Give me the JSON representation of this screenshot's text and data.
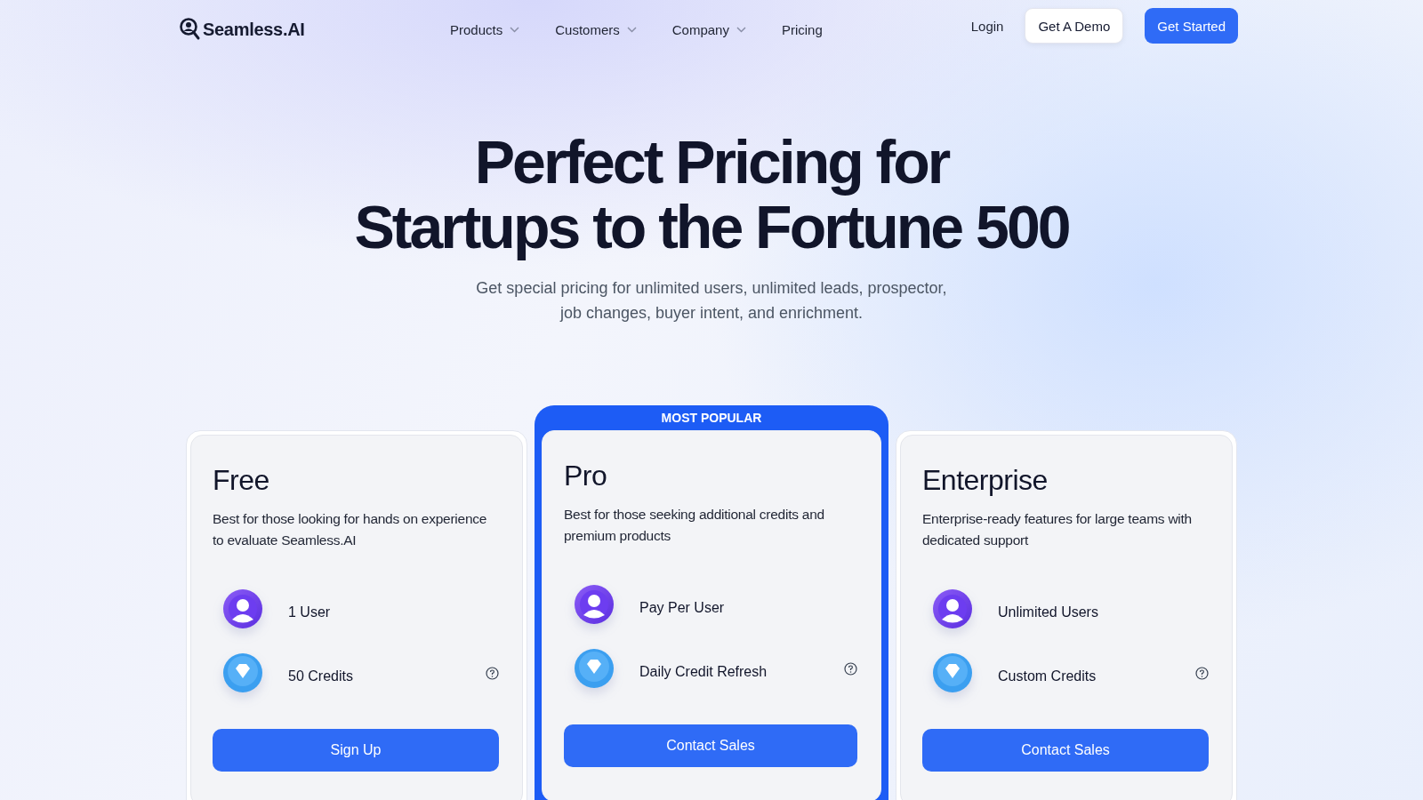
{
  "nav": {
    "logo": "Seamless.AI",
    "menu": [
      {
        "label": "Products",
        "dropdown": true
      },
      {
        "label": "Customers",
        "dropdown": true
      },
      {
        "label": "Company",
        "dropdown": true
      },
      {
        "label": "Pricing",
        "dropdown": false
      }
    ],
    "login": "Login",
    "demo_button": "Get A Demo",
    "start_button": "Get Started"
  },
  "hero": {
    "title_lines": [
      "Perfect Pricing for",
      "Startups to the Fortune 500"
    ],
    "subtitle_lines": [
      "Get special pricing for unlimited users, unlimited leads, prospector,",
      "job changes, buyer intent, and enrichment."
    ]
  },
  "plans": [
    {
      "name": "Free",
      "popular": false,
      "description": "Best for those looking for hands on experience to evaluate Seamless.AI",
      "features": [
        {
          "kind": "user",
          "label": "1 User",
          "help": false
        },
        {
          "kind": "credits",
          "label": "50 Credits",
          "help": true
        }
      ],
      "button": "Sign Up"
    },
    {
      "name": "Pro",
      "popular": true,
      "badge": "MOST POPULAR",
      "description": "Best for those seeking additional credits and premium products",
      "features": [
        {
          "kind": "user",
          "label": "Pay Per User",
          "help": false
        },
        {
          "kind": "credits",
          "label": "Daily Credit Refresh",
          "help": true
        }
      ],
      "button": "Contact Sales"
    },
    {
      "name": "Enterprise",
      "popular": false,
      "description": "Enterprise-ready features for large teams with dedicated support",
      "features": [
        {
          "kind": "user",
          "label": "Unlimited Users",
          "help": false
        },
        {
          "kind": "credits",
          "label": "Custom Credits",
          "help": true
        }
      ],
      "button": "Contact Sales"
    }
  ]
}
